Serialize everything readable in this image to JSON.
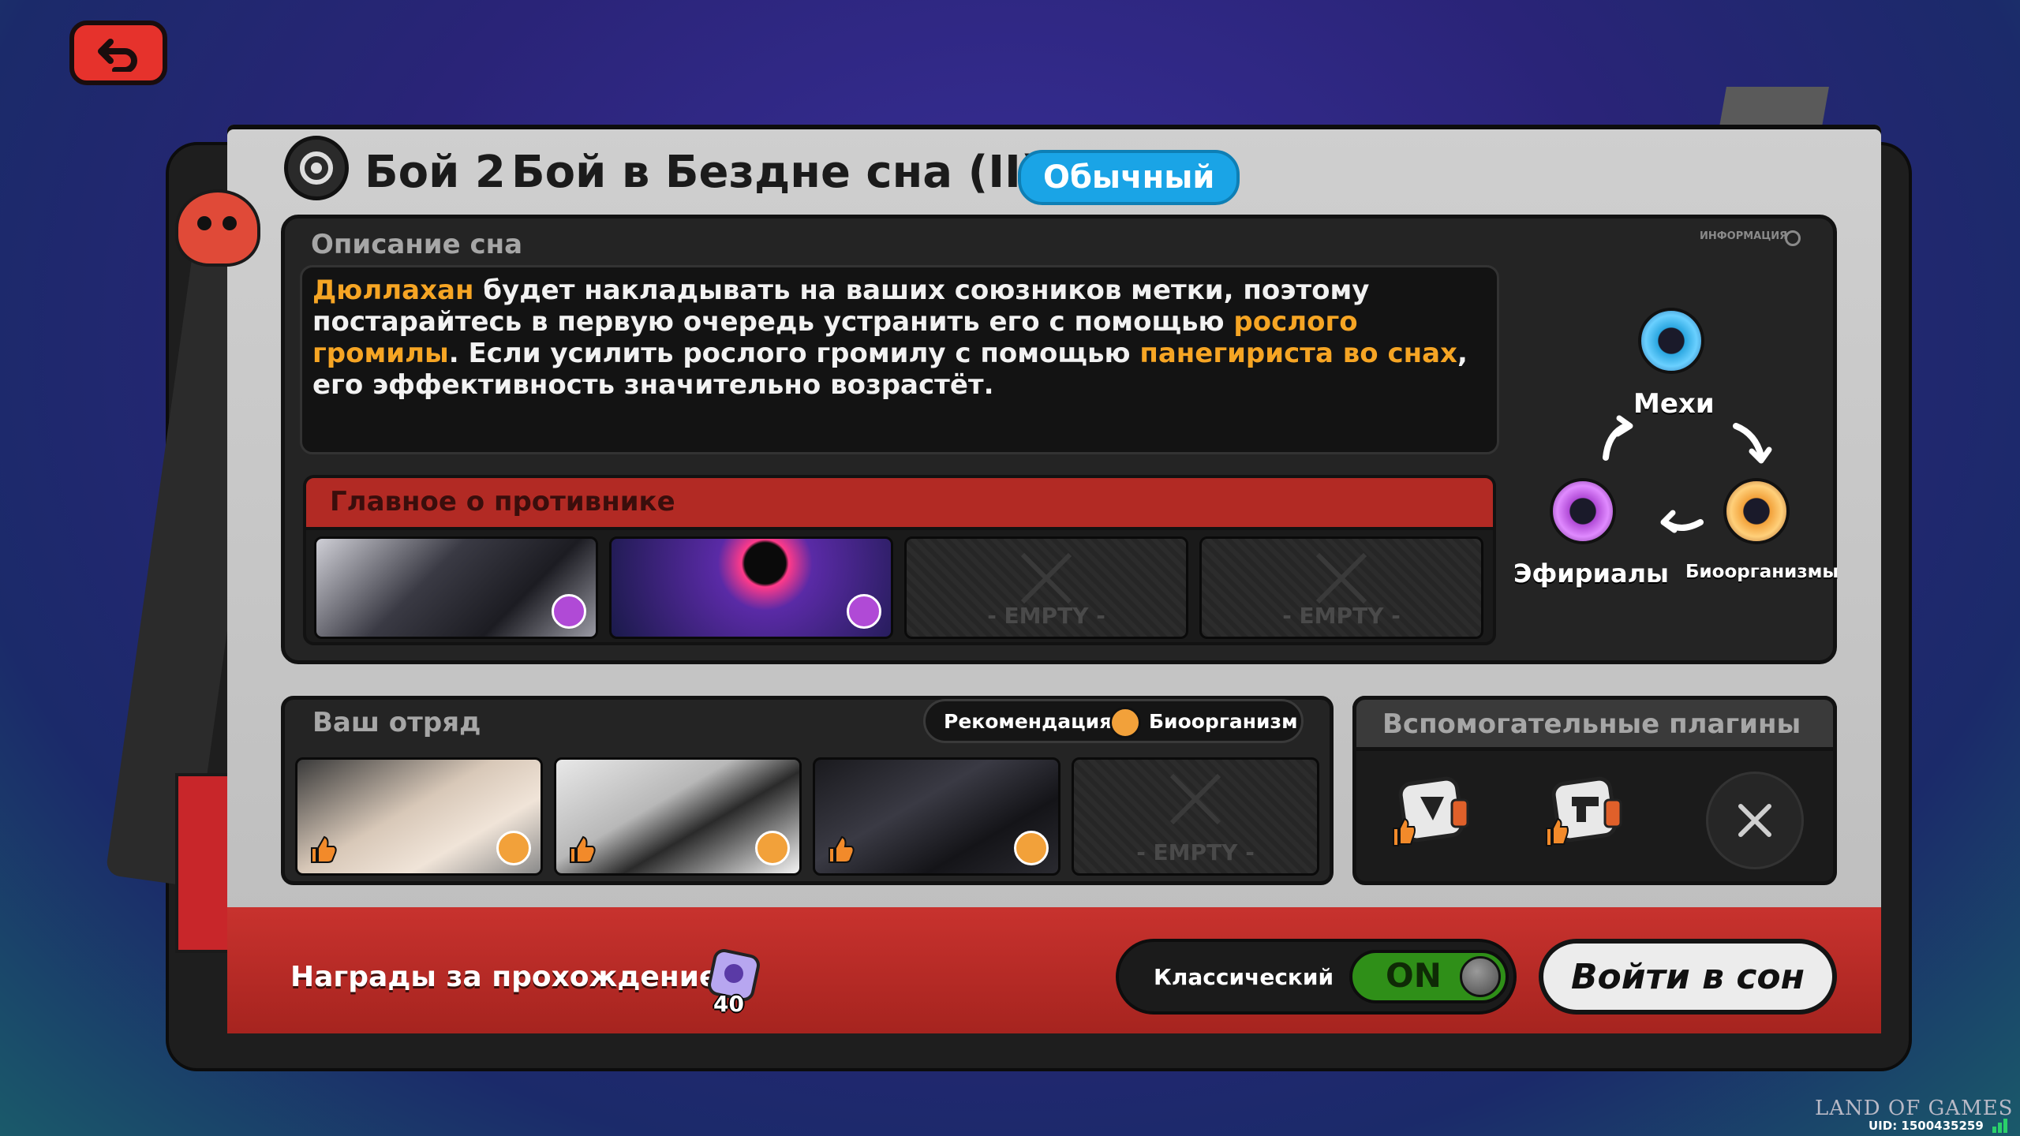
{
  "title": {
    "battle": "Бой 2",
    "name": "Бой в Бездне сна (II)",
    "difficulty": "Обычный"
  },
  "dream": {
    "heading": "Описание сна",
    "info_label": "ИНФОРМАЦИЯ",
    "description": {
      "p1": "Дюллахан",
      "p2": " будет накладывать на ваших союзников метки, поэтому постарайтесь в первую очередь устранить его с помощью ",
      "p3": "рослого громилы",
      "p4": ". Если усилить рослого громилу с помощью ",
      "p5": "панегириста во снах",
      "p6": ", его эффективность значительно возрастёт."
    }
  },
  "enemy": {
    "heading": "Главное о противнике",
    "slots": [
      {
        "state": "filled",
        "faction": "Эфириалы"
      },
      {
        "state": "filled",
        "faction": "Эфириалы"
      },
      {
        "state": "empty",
        "label": "- EMPTY -"
      },
      {
        "state": "empty",
        "label": "- EMPTY -"
      }
    ]
  },
  "factions": {
    "top": "Мехи",
    "left": "Эфириалы",
    "right": "Биоорганизмы",
    "colors": {
      "mech": "#2aa6e0",
      "ether": "#b04ad6",
      "bio": "#f2a13a"
    }
  },
  "squad": {
    "heading": "Ваш отряд",
    "recommend_label": "Рекомендация:",
    "recommend_value": "Биоорганизм",
    "slots": [
      {
        "state": "filled",
        "faction": "Биоорганизмы"
      },
      {
        "state": "filled",
        "faction": "Биоорганизмы"
      },
      {
        "state": "filled",
        "faction": "Биоорганизмы"
      },
      {
        "state": "empty",
        "label": "- EMPTY -"
      }
    ]
  },
  "plugins": {
    "heading": "Вспомогательные плагины",
    "items": [
      "plugin-1",
      "plugin-2"
    ]
  },
  "footer": {
    "rewards_label": "Награды за прохождение:",
    "reward_count": "40",
    "mode_label": "Классический",
    "toggle": "ON",
    "enter_button": "Войти в сон"
  },
  "overlay": {
    "watermark": "LAND OF GAMES",
    "uid": "UID: 1500435259"
  }
}
